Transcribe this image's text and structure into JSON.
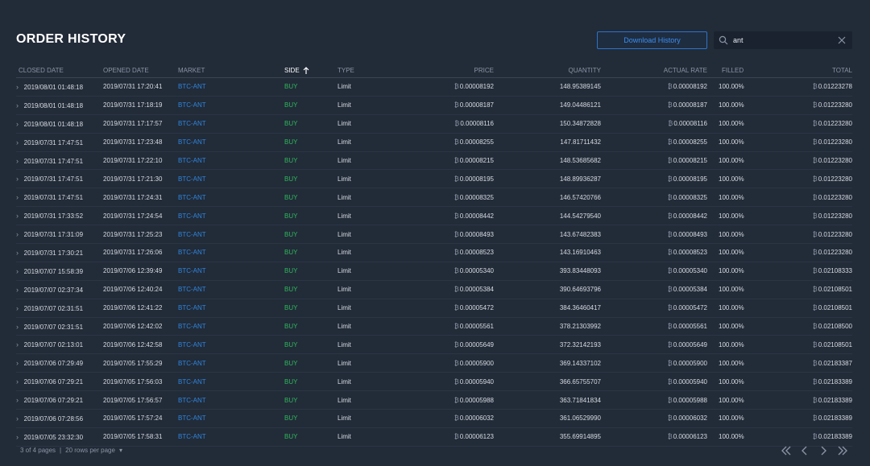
{
  "title": "ORDER HISTORY",
  "download_label": "Download History",
  "search": {
    "value": "ant"
  },
  "columns": {
    "closed_date": "CLOSED DATE",
    "opened_date": "OPENED DATE",
    "market": "MARKET",
    "side": "SIDE",
    "type": "TYPE",
    "price": "PRICE",
    "quantity": "QUANTITY",
    "actual_rate": "ACTUAL RATE",
    "filled": "FILLED",
    "total": "TOTAL"
  },
  "currency_symbol": "₿",
  "rows": [
    [
      "2019/08/01 01:48:18",
      "2019/07/31 17:20:41",
      "BTC-ANT",
      "BUY",
      "Limit",
      "0.00008192",
      "148.95389145",
      "0.00008192",
      "100.00%",
      "0.01223278"
    ],
    [
      "2019/08/01 01:48:18",
      "2019/07/31 17:18:19",
      "BTC-ANT",
      "BUY",
      "Limit",
      "0.00008187",
      "149.04486121",
      "0.00008187",
      "100.00%",
      "0.01223280"
    ],
    [
      "2019/08/01 01:48:18",
      "2019/07/31 17:17:57",
      "BTC-ANT",
      "BUY",
      "Limit",
      "0.00008116",
      "150.34872828",
      "0.00008116",
      "100.00%",
      "0.01223280"
    ],
    [
      "2019/07/31 17:47:51",
      "2019/07/31 17:23:48",
      "BTC-ANT",
      "BUY",
      "Limit",
      "0.00008255",
      "147.81711432",
      "0.00008255",
      "100.00%",
      "0.01223280"
    ],
    [
      "2019/07/31 17:47:51",
      "2019/07/31 17:22:10",
      "BTC-ANT",
      "BUY",
      "Limit",
      "0.00008215",
      "148.53685682",
      "0.00008215",
      "100.00%",
      "0.01223280"
    ],
    [
      "2019/07/31 17:47:51",
      "2019/07/31 17:21:30",
      "BTC-ANT",
      "BUY",
      "Limit",
      "0.00008195",
      "148.89936287",
      "0.00008195",
      "100.00%",
      "0.01223280"
    ],
    [
      "2019/07/31 17:47:51",
      "2019/07/31 17:24:31",
      "BTC-ANT",
      "BUY",
      "Limit",
      "0.00008325",
      "146.57420766",
      "0.00008325",
      "100.00%",
      "0.01223280"
    ],
    [
      "2019/07/31 17:33:52",
      "2019/07/31 17:24:54",
      "BTC-ANT",
      "BUY",
      "Limit",
      "0.00008442",
      "144.54279540",
      "0.00008442",
      "100.00%",
      "0.01223280"
    ],
    [
      "2019/07/31 17:31:09",
      "2019/07/31 17:25:23",
      "BTC-ANT",
      "BUY",
      "Limit",
      "0.00008493",
      "143.67482383",
      "0.00008493",
      "100.00%",
      "0.01223280"
    ],
    [
      "2019/07/31 17:30:21",
      "2019/07/31 17:26:06",
      "BTC-ANT",
      "BUY",
      "Limit",
      "0.00008523",
      "143.16910463",
      "0.00008523",
      "100.00%",
      "0.01223280"
    ],
    [
      "2019/07/07 15:58:39",
      "2019/07/06 12:39:49",
      "BTC-ANT",
      "BUY",
      "Limit",
      "0.00005340",
      "393.83448093",
      "0.00005340",
      "100.00%",
      "0.02108333"
    ],
    [
      "2019/07/07 02:37:34",
      "2019/07/06 12:40:24",
      "BTC-ANT",
      "BUY",
      "Limit",
      "0.00005384",
      "390.64693796",
      "0.00005384",
      "100.00%",
      "0.02108501"
    ],
    [
      "2019/07/07 02:31:51",
      "2019/07/06 12:41:22",
      "BTC-ANT",
      "BUY",
      "Limit",
      "0.00005472",
      "384.36460417",
      "0.00005472",
      "100.00%",
      "0.02108501"
    ],
    [
      "2019/07/07 02:31:51",
      "2019/07/06 12:42:02",
      "BTC-ANT",
      "BUY",
      "Limit",
      "0.00005561",
      "378.21303992",
      "0.00005561",
      "100.00%",
      "0.02108500"
    ],
    [
      "2019/07/07 02:13:01",
      "2019/07/06 12:42:58",
      "BTC-ANT",
      "BUY",
      "Limit",
      "0.00005649",
      "372.32142193",
      "0.00005649",
      "100.00%",
      "0.02108501"
    ],
    [
      "2019/07/06 07:29:49",
      "2019/07/05 17:55:29",
      "BTC-ANT",
      "BUY",
      "Limit",
      "0.00005900",
      "369.14337102",
      "0.00005900",
      "100.00%",
      "0.02183387"
    ],
    [
      "2019/07/06 07:29:21",
      "2019/07/05 17:56:03",
      "BTC-ANT",
      "BUY",
      "Limit",
      "0.00005940",
      "366.65755707",
      "0.00005940",
      "100.00%",
      "0.02183389"
    ],
    [
      "2019/07/06 07:29:21",
      "2019/07/05 17:56:57",
      "BTC-ANT",
      "BUY",
      "Limit",
      "0.00005988",
      "363.71841834",
      "0.00005988",
      "100.00%",
      "0.02183389"
    ],
    [
      "2019/07/06 07:28:56",
      "2019/07/05 17:57:24",
      "BTC-ANT",
      "BUY",
      "Limit",
      "0.00006032",
      "361.06529990",
      "0.00006032",
      "100.00%",
      "0.02183389"
    ],
    [
      "2019/07/05 23:32:30",
      "2019/07/05 17:58:31",
      "BTC-ANT",
      "BUY",
      "Limit",
      "0.00006123",
      "355.69914895",
      "0.00006123",
      "100.00%",
      "0.02183389"
    ]
  ],
  "footer": {
    "pages": "3 of 4 pages",
    "separator": "|",
    "rows_per_page": "20 rows per page"
  },
  "colors": {
    "background": "#222b38",
    "accent": "#2e86de",
    "buy": "#2eb85c"
  }
}
